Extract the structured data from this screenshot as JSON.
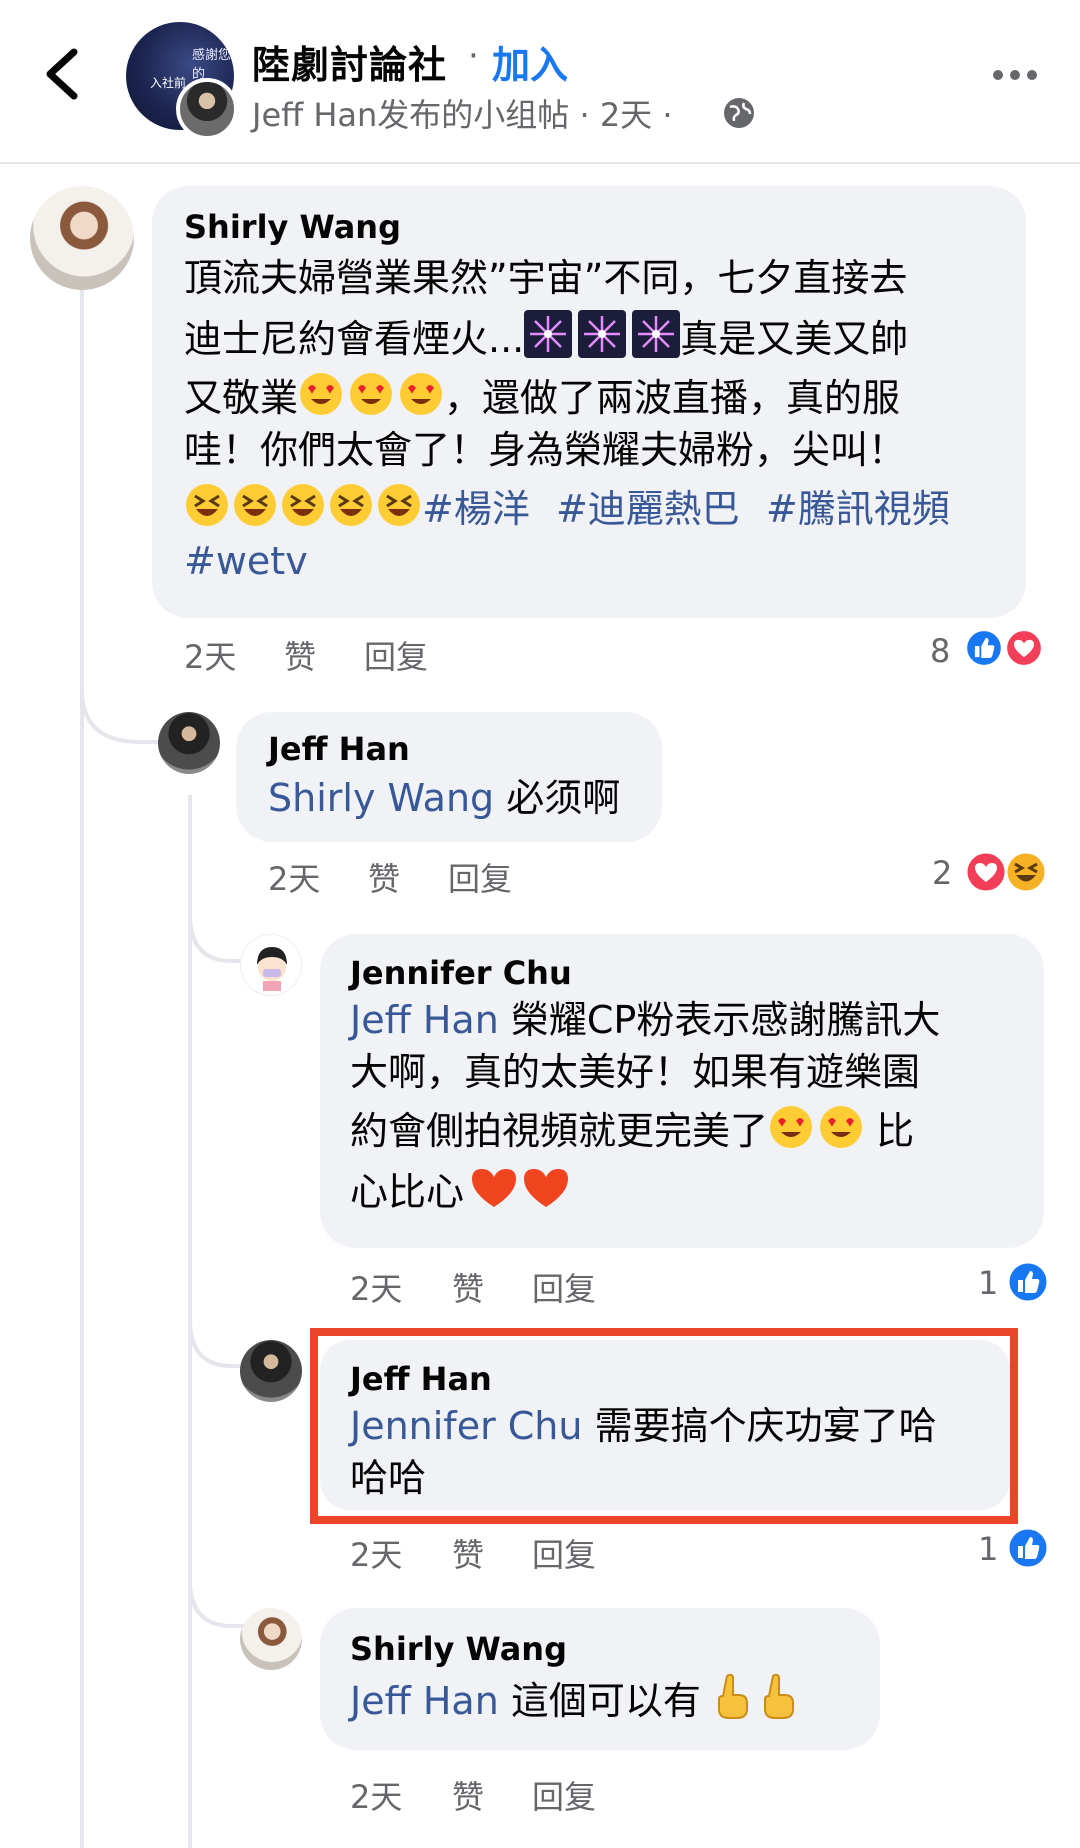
{
  "header": {
    "group_name": "陸劇討論社",
    "separator": "·",
    "join_label": "加入",
    "post_meta": "Jeff Han发布的小组帖 · 2天 ·",
    "group_avatar_text_top": "感謝您的",
    "group_avatar_text_left": "入社前"
  },
  "comments": [
    {
      "author": "Shirly Wang",
      "text_lines": [
        "頂流夫婦營業果然”宇宙”不同，七夕直接去",
        "迪士尼約會看煙火...",
        "真是又美又帥",
        "又敬業",
        "，還做了兩波直播，真的服",
        "哇！你們太會了！身為榮耀夫婦粉，尖叫！"
      ],
      "tags": [
        "#楊洋",
        "#迪麗熱巴",
        "#騰訊視頻",
        "#wetv"
      ],
      "time": "2天",
      "like_label": "赞",
      "reply_label": "回复",
      "reaction_count": "8",
      "reactions": [
        "like-icon",
        "love-icon"
      ]
    },
    {
      "author": "Jeff Han",
      "mention": "Shirly Wang",
      "text": " 必须啊",
      "time": "2天",
      "like_label": "赞",
      "reply_label": "回复",
      "reaction_count": "2",
      "reactions": [
        "love-icon",
        "haha-icon"
      ]
    },
    {
      "author": "Jennifer Chu",
      "mention": "Jeff Han",
      "text_line1": " 榮耀CP粉表示感謝騰訊大",
      "text_line2": "大啊，真的太美好！如果有遊樂園",
      "text_line3": "約會側拍視頻就更完美了",
      "text_line3_tail": " 比",
      "text_line4": "心比心",
      "time": "2天",
      "like_label": "赞",
      "reply_label": "回复",
      "reaction_count": "1",
      "reactions": [
        "like-icon"
      ]
    },
    {
      "author": "Jeff Han",
      "mention": "Jennifer Chu",
      "text_line1": " 需要搞个庆功宴了哈",
      "text_line2": "哈哈",
      "time": "2天",
      "like_label": "赞",
      "reply_label": "回复",
      "reaction_count": "1",
      "reactions": [
        "like-icon"
      ]
    },
    {
      "author": "Shirly Wang",
      "mention": "Jeff Han",
      "text": " 這個可以有",
      "time": "2天",
      "like_label": "赞",
      "reply_label": "回复"
    }
  ],
  "colors": {
    "accent": "#1877f2",
    "mention": "#385898",
    "highlight_border": "#ea4528",
    "bubble": "#f0f2f5"
  }
}
